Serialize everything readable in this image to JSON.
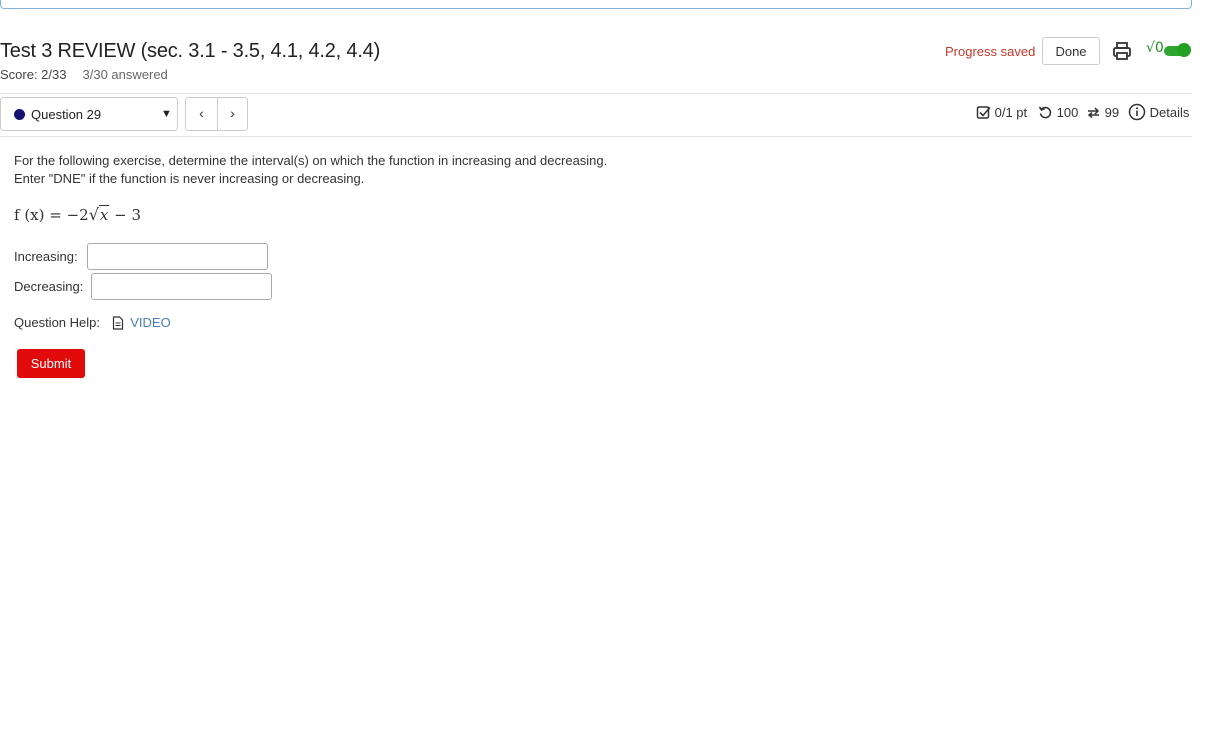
{
  "header": {
    "title": "Test 3 REVIEW (sec. 3.1 - 3.5, 4.1, 4.2, 4.4)",
    "score": "Score: 2/33",
    "answered": "3/30 answered",
    "progress_text": "Progress saved",
    "done_label": "Done",
    "math_toggle_label": "√0",
    "math_toggle_on": true
  },
  "question_nav": {
    "selected_question": "Question 29",
    "status_color": "#14146e",
    "prev_label": "‹",
    "next_label": "›"
  },
  "stats": {
    "points": "0/1 pt",
    "retries": "100",
    "attempts": "99",
    "details_label": "Details"
  },
  "question": {
    "prompt": "For the following exercise, determine the interval(s) on which the function in increasing and decreasing. Enter \"DNE\" if the function is never increasing or decreasing.",
    "formula_lhs": "f (x) = −2",
    "formula_radicand": "x",
    "formula_rhs": " − 3",
    "fields": [
      {
        "label": "Increasing:",
        "value": ""
      },
      {
        "label": "Decreasing:",
        "value": ""
      }
    ],
    "help_label": "Question Help:",
    "help_link": "VIDEO",
    "submit_label": "Submit"
  },
  "colors": {
    "accent_red": "#e10b0b",
    "progress_red": "#c0392b",
    "toggle_green": "#2fa52f",
    "link_blue": "#4a7fb0"
  }
}
